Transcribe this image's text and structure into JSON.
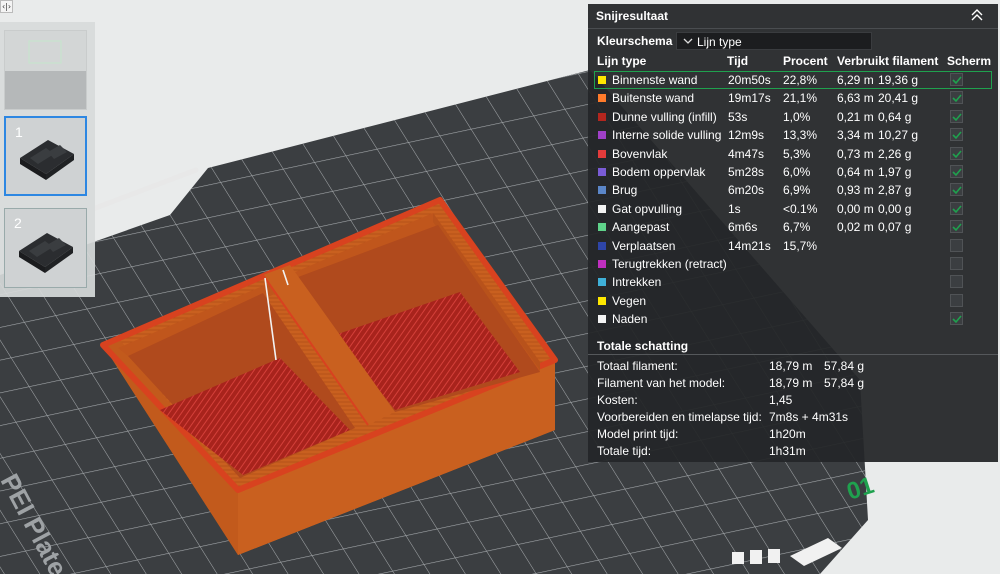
{
  "viewport": {
    "plate_label": "PEI Plate",
    "plate_number": "01"
  },
  "top_toggle": {
    "label": "‹|›"
  },
  "plates": [
    {
      "number": ""
    },
    {
      "number": "1"
    },
    {
      "number": "2"
    }
  ],
  "panel": {
    "title": "Snijresultaat",
    "color_scheme_label": "Kleurschema",
    "color_scheme_value": "Lijn type",
    "headers": {
      "type": "Lijn type",
      "time": "Tijd",
      "percent": "Procent",
      "usage": "Verbruikt filament",
      "display": "Scherm"
    },
    "rows": [
      {
        "name": "Binnenste wand",
        "color": "#ffe600",
        "time": "20m50s",
        "percent": "22,8%",
        "length": "6,29 m",
        "weight": "19,36 g",
        "shown": true
      },
      {
        "name": "Buitenste wand",
        "color": "#ff7b2b",
        "time": "19m17s",
        "percent": "21,1%",
        "length": "6,63 m",
        "weight": "20,41 g",
        "shown": true
      },
      {
        "name": "Dunne vulling (infill)",
        "color": "#b3261e",
        "time": "53s",
        "percent": "1,0%",
        "length": "0,21 m",
        "weight": "0,64 g",
        "shown": true
      },
      {
        "name": "Interne solide vulling",
        "color": "#a040c8",
        "time": "12m9s",
        "percent": "13,3%",
        "length": "3,34 m",
        "weight": "10,27 g",
        "shown": true
      },
      {
        "name": "Bovenvlak",
        "color": "#e33b3b",
        "time": "4m47s",
        "percent": "5,3%",
        "length": "0,73 m",
        "weight": "2,26 g",
        "shown": true
      },
      {
        "name": "Bodem oppervlak",
        "color": "#7a5cd6",
        "time": "5m28s",
        "percent": "6,0%",
        "length": "0,64 m",
        "weight": "1,97 g",
        "shown": true
      },
      {
        "name": "Brug",
        "color": "#5b86c8",
        "time": "6m20s",
        "percent": "6,9%",
        "length": "0,93 m",
        "weight": "2,87 g",
        "shown": true
      },
      {
        "name": "Gat opvulling",
        "color": "#f2f2f2",
        "time": "1s",
        "percent": "<0.1%",
        "length": "0,00 m",
        "weight": "0,00 g",
        "shown": true
      },
      {
        "name": "Aangepast",
        "color": "#5fd38a",
        "time": "6m6s",
        "percent": "6,7%",
        "length": "0,02 m",
        "weight": "0,07 g",
        "shown": true
      },
      {
        "name": "Verplaatsen",
        "color": "#2e45a8",
        "time": "14m21s",
        "percent": "15,7%",
        "length": "",
        "weight": "",
        "shown": false
      },
      {
        "name": "Terugtrekken (retract)",
        "color": "#c02fc0",
        "time": "",
        "percent": "",
        "length": "",
        "weight": "",
        "shown": false
      },
      {
        "name": "Intrekken",
        "color": "#3fb0d8",
        "time": "",
        "percent": "",
        "length": "",
        "weight": "",
        "shown": false
      },
      {
        "name": "Vegen",
        "color": "#ffe800",
        "time": "",
        "percent": "",
        "length": "",
        "weight": "",
        "shown": false
      },
      {
        "name": "Naden",
        "color": "#f4f4f4",
        "time": "",
        "percent": "",
        "length": "",
        "weight": "",
        "shown": true
      }
    ],
    "totals_title": "Totale schatting",
    "totals": [
      {
        "label": "Totaal filament:",
        "v1": "18,79 m",
        "v2": "57,84 g"
      },
      {
        "label": "Filament van het model:",
        "v1": "18,79 m",
        "v2": "57,84 g"
      },
      {
        "label": "Kosten:",
        "v1": "1,45",
        "v2": ""
      },
      {
        "label": "Voorbereiden en timelapse tijd:",
        "v1": "7m8s + 4m31s",
        "v2": ""
      },
      {
        "label": "Model print tijd:",
        "v1": "1h20m",
        "v2": ""
      },
      {
        "label": "Totale tijd:",
        "v1": "1h31m",
        "v2": ""
      }
    ]
  },
  "colors": {
    "model_orange": "#c9601f",
    "model_red_infill": "#b22a22",
    "plate_dark": "#3a3d40",
    "selected_green": "#1fa14e",
    "selected_plate_blue": "#2d87e2"
  }
}
